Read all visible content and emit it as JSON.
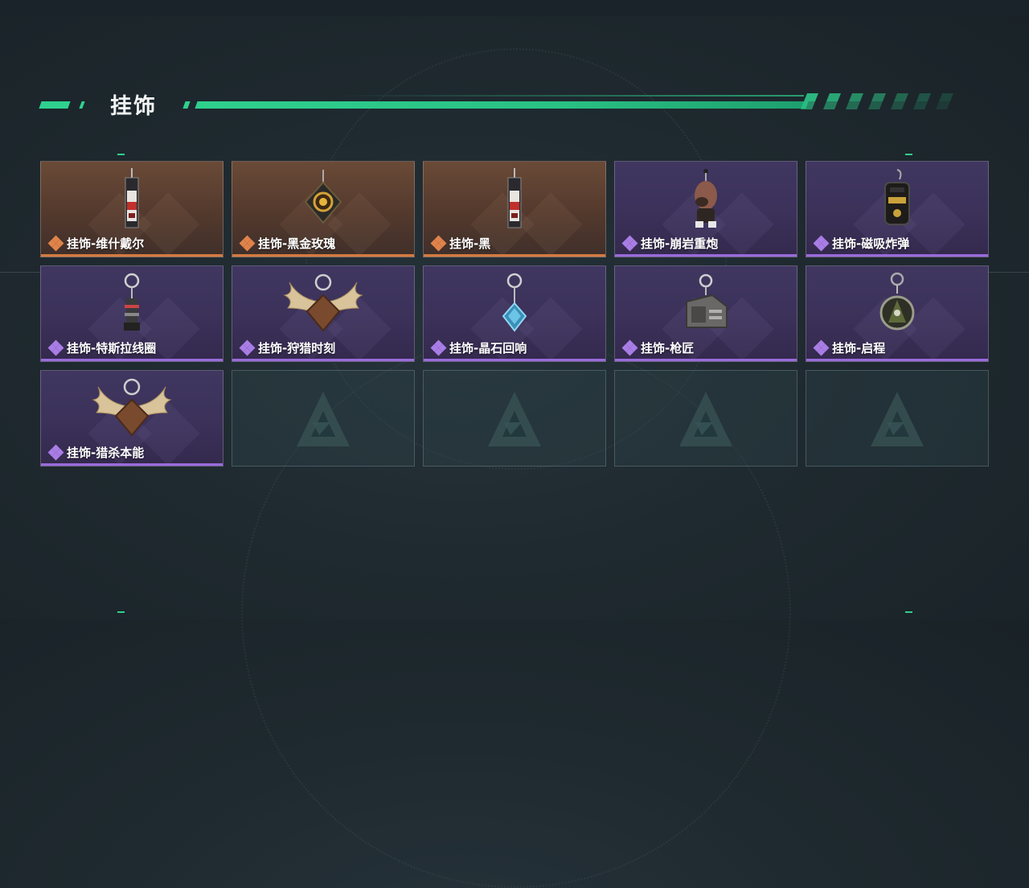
{
  "section": {
    "title": "挂饰"
  },
  "colors": {
    "accent": "#2fd08e",
    "orange_rarity": "#d47a41",
    "purple_rarity": "#9a6bdb"
  },
  "items": [
    {
      "label": "挂饰-维什戴尔",
      "rarity": "orange",
      "icon": "tall-tag-charm-icon"
    },
    {
      "label": "挂饰-黑金玫瑰",
      "rarity": "orange",
      "icon": "rose-pendant-charm-icon"
    },
    {
      "label": "挂饰-黑",
      "rarity": "orange",
      "icon": "tall-tag-charm-icon"
    },
    {
      "label": "挂饰-崩岩重炮",
      "rarity": "purple",
      "icon": "figure-charm-icon"
    },
    {
      "label": "挂饰-磁吸炸弹",
      "rarity": "purple",
      "icon": "bomb-charm-icon"
    },
    {
      "label": "挂饰-特斯拉线圈",
      "rarity": "purple",
      "icon": "coil-charm-icon"
    },
    {
      "label": "挂饰-狩猎时刻",
      "rarity": "purple",
      "icon": "antler-charm-icon"
    },
    {
      "label": "挂饰-晶石回响",
      "rarity": "purple",
      "icon": "crystal-charm-icon"
    },
    {
      "label": "挂饰-枪匠",
      "rarity": "purple",
      "icon": "workbench-charm-icon"
    },
    {
      "label": "挂饰-启程",
      "rarity": "purple",
      "icon": "medal-charm-icon"
    },
    {
      "label": "挂饰-猎杀本能",
      "rarity": "purple",
      "icon": "antler-charm-icon"
    }
  ],
  "empty_slot_icon": "triangle-logo-icon"
}
